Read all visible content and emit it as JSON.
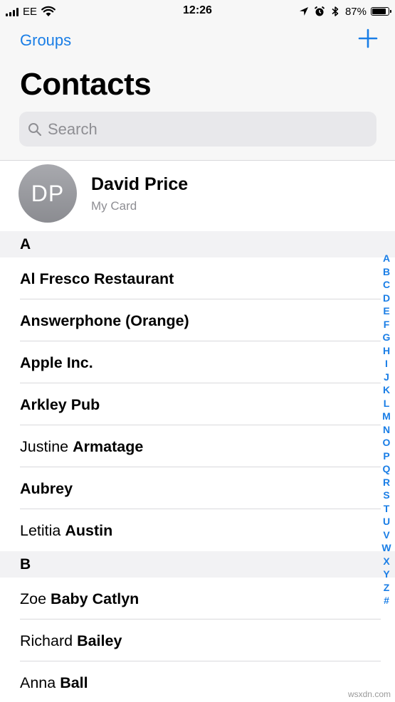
{
  "status_bar": {
    "carrier": "EE",
    "time": "12:26",
    "battery_percent": "87%",
    "battery_level": 0.87,
    "icons": [
      "signal-icon",
      "wifi-icon",
      "location-icon",
      "alarm-icon",
      "bluetooth-icon",
      "battery-icon"
    ]
  },
  "nav": {
    "groups_label": "Groups",
    "title": "Contacts",
    "search_placeholder": "Search",
    "add_icon": "plus-icon"
  },
  "my_card": {
    "initials": "DP",
    "name": "David Price",
    "subtitle": "My Card"
  },
  "sections": [
    {
      "letter": "A",
      "contacts": [
        {
          "first": "",
          "last": "Al Fresco Restaurant"
        },
        {
          "first": "",
          "last": "Answerphone (Orange)"
        },
        {
          "first": "",
          "last": "Apple Inc."
        },
        {
          "first": "",
          "last": "Arkley Pub"
        },
        {
          "first": "Justine",
          "last": "Armatage"
        },
        {
          "first": "",
          "last": "Aubrey"
        },
        {
          "first": "Letitia",
          "last": "Austin"
        }
      ]
    },
    {
      "letter": "B",
      "contacts": [
        {
          "first": "Zoe",
          "last": "Baby Catlyn"
        },
        {
          "first": "Richard",
          "last": "Bailey"
        },
        {
          "first": "Anna",
          "last": "Ball"
        }
      ]
    }
  ],
  "index_letters": [
    "A",
    "B",
    "C",
    "D",
    "E",
    "F",
    "G",
    "H",
    "I",
    "J",
    "K",
    "L",
    "M",
    "N",
    "O",
    "P",
    "Q",
    "R",
    "S",
    "T",
    "U",
    "V",
    "W",
    "X",
    "Y",
    "Z",
    "#"
  ],
  "watermark": "wsxdn.com",
  "colors": {
    "accent": "#1a7ee6",
    "secondary_text": "#8e8e93",
    "section_bg": "#f2f2f4",
    "nav_bg": "#f7f7f7"
  }
}
